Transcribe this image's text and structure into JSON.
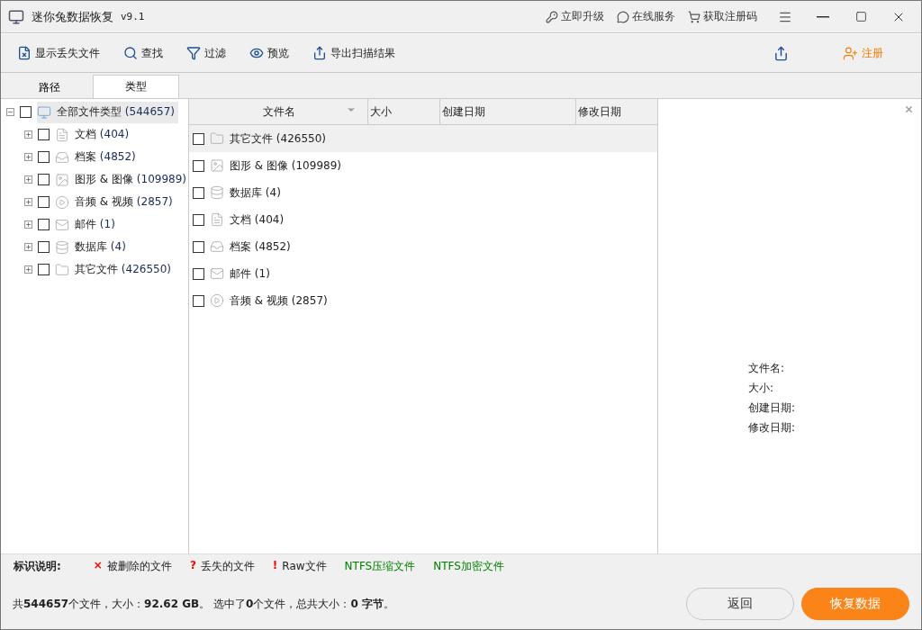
{
  "window": {
    "title": "迷你兔数据恢复",
    "version": "v9.1"
  },
  "title_links": [
    {
      "kind": "upgrade",
      "label": "立即升级"
    },
    {
      "kind": "service",
      "label": "在线服务"
    },
    {
      "kind": "cart",
      "label": "获取注册码"
    }
  ],
  "toolbar": [
    {
      "kind": "lost",
      "label": "显示丢失文件"
    },
    {
      "kind": "search",
      "label": "查找"
    },
    {
      "kind": "filter",
      "label": "过滤"
    },
    {
      "kind": "preview",
      "label": "预览"
    },
    {
      "kind": "export",
      "label": "导出扫描结果"
    }
  ],
  "register": {
    "label": "注册"
  },
  "tabs": [
    {
      "label": "路径",
      "selected": false
    },
    {
      "label": "类型",
      "selected": true
    }
  ],
  "tree": [
    {
      "kind": "monitor",
      "label": "全部文件类型",
      "count": "(544657)",
      "checked": false,
      "expanded": true,
      "selected": true,
      "children": [
        {
          "kind": "doc",
          "label": "文档",
          "count": "(404)",
          "checked": false,
          "expanded": false,
          "selected": false
        },
        {
          "kind": "archive",
          "label": "档案",
          "count": "(4852)",
          "checked": false,
          "expanded": false,
          "selected": false
        },
        {
          "kind": "image",
          "label": "图形 & 图像",
          "count": "(109989)",
          "checked": false,
          "expanded": false,
          "selected": false
        },
        {
          "kind": "media",
          "label": "音频 & 视频",
          "count": "(2857)",
          "checked": false,
          "expanded": false,
          "selected": false
        },
        {
          "kind": "mail",
          "label": "邮件",
          "count": "(1)",
          "checked": false,
          "expanded": false,
          "selected": false
        },
        {
          "kind": "database",
          "label": "数据库",
          "count": "(4)",
          "checked": false,
          "expanded": false,
          "selected": false
        },
        {
          "kind": "folder",
          "label": "其它文件",
          "count": "(426550)",
          "checked": false,
          "expanded": false,
          "selected": false
        }
      ]
    }
  ],
  "table": {
    "columns": [
      {
        "label": "文件名",
        "sorted": true
      },
      {
        "label": "大小",
        "sorted": false
      },
      {
        "label": "创建日期",
        "sorted": false
      },
      {
        "label": "修改日期",
        "sorted": false
      }
    ],
    "rows": [
      {
        "kind": "folder",
        "name": "其它文件 (426550)",
        "checked": false,
        "selected": true
      },
      {
        "kind": "image",
        "name": "图形 & 图像 (109989)",
        "checked": false,
        "selected": false
      },
      {
        "kind": "database",
        "name": "数据库 (4)",
        "checked": false,
        "selected": false
      },
      {
        "kind": "doc",
        "name": "文档 (404)",
        "checked": false,
        "selected": false
      },
      {
        "kind": "archive",
        "name": "档案 (4852)",
        "checked": false,
        "selected": false
      },
      {
        "kind": "mail",
        "name": "邮件 (1)",
        "checked": false,
        "selected": false
      },
      {
        "kind": "media",
        "name": "音频 & 视频 (2857)",
        "checked": false,
        "selected": false
      }
    ]
  },
  "preview": {
    "fields": [
      "文件名:",
      "大小:",
      "创建日期:",
      "修改日期:"
    ]
  },
  "legend": {
    "title": "标识说明:",
    "items": [
      {
        "mark": "×",
        "label": "被删除的文件",
        "color": "#ff0000"
      },
      {
        "mark": "?",
        "label": "丢失的文件",
        "color": "#ff0000"
      },
      {
        "mark": "!",
        "label": "Raw文件",
        "color": "#ff0000"
      },
      {
        "label": "NTFS压缩文件",
        "color": "#008000"
      },
      {
        "label": "NTFS加密文件",
        "color": "#008000"
      }
    ]
  },
  "status": "共**544657**个文件，大小：**92.62 GB**。 选中了**0**个文件，总共大小：**0 字节**。",
  "buttons": [
    {
      "kind": "secondary",
      "label": "返回"
    },
    {
      "kind": "primary",
      "label": "恢复数据"
    }
  ]
}
